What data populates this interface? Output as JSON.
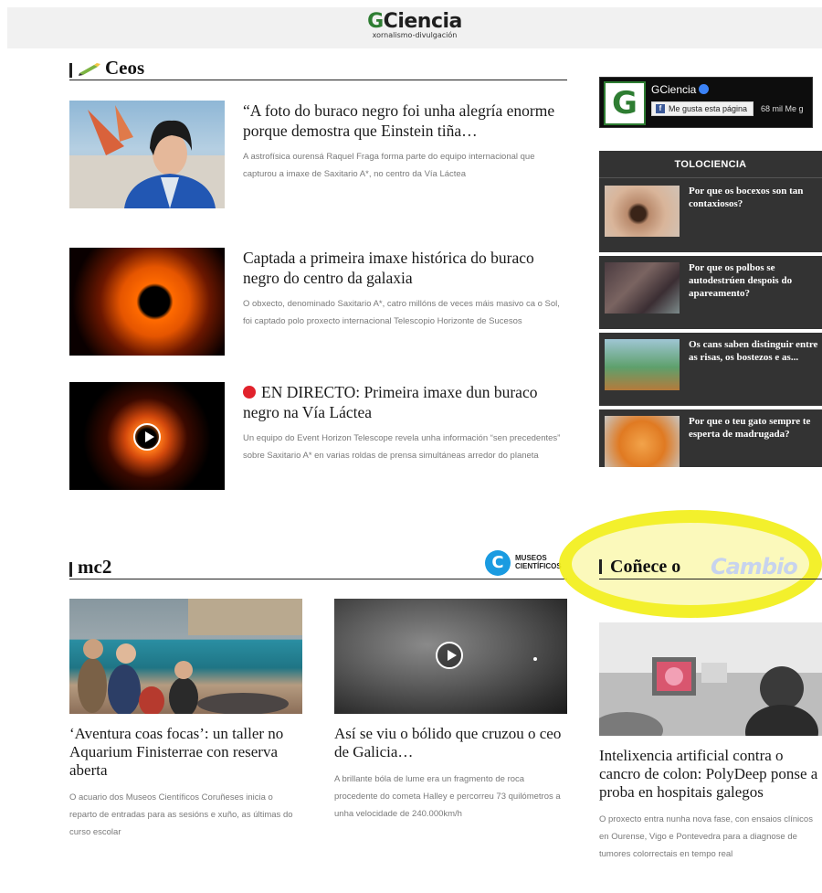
{
  "brand": {
    "logo_primary": "G",
    "logo_rest": "Ciencia",
    "tagline": "xornalismo-divulgación",
    "accent_color": "#2e7d32"
  },
  "ceos": {
    "section_title": "Ceos",
    "articles": [
      {
        "title": "“A foto do buraco negro foi unha alegría enorme porque demostra que Einstein tiña…",
        "excerpt": "A astrofísica ourensá Raquel Fraga forma parte do equipo internacional que capturou a imaxe de Saxitario A*, no centro da Vía Láctea",
        "live": ""
      },
      {
        "title": "Captada a primeira imaxe histórica do buraco negro do centro da galaxia",
        "excerpt": "O obxecto, denominado Saxitario A*, catro millóns de veces máis masivo ca o Sol, foi captado polo proxecto internacional Telescopio Horizonte de Sucesos",
        "live": ""
      },
      {
        "title": "EN DIRECTO: Primeira imaxe dun buraco negro na Vía Láctea",
        "excerpt": "Un equipo do Event Horizon Telescope revela unha información “sen precedentes” sobre Saxitario A* en varias roldas de prensa simultáneas arredor do planeta",
        "live": "true"
      }
    ]
  },
  "facebook": {
    "page_name": "GCiencia",
    "like_label": "Me gusta esta página",
    "likes": "68 mil Me g",
    "logo_letter": "G"
  },
  "toloscience": {
    "title": "TOLOCIENCIA",
    "items": [
      {
        "title": "Por que os bocexos son tan contaxiosos?"
      },
      {
        "title": "Por que os polbos se autodestrúen despois do apareamento?"
      },
      {
        "title": "Os cans saben distinguir entre as risas, os bostezos e as..."
      },
      {
        "title": "Por que o teu gato sempre te esperta de madrugada?"
      }
    ]
  },
  "mc2": {
    "section_title": "mc2",
    "logo_letter": "C",
    "logo_line1": "MUSEOS",
    "logo_line2": "CIENTÍFICOS",
    "articles": [
      {
        "title": "‘Aventura coas focas’: un taller no Aquarium Finisterrae con reserva aberta",
        "excerpt": "O acuario dos Museos Científicos Coruñeses inicia o reparto de entradas para as sesións e xuño, as últimas do curso escolar"
      },
      {
        "title": "Así se viu o bólido que cruzou o ceo de Galicia…",
        "excerpt": "A brillante bóla de lume era un fragmento de roca procedente do cometa Halley e percorreu 73 quilómetros a unha velocidade de 240.000km/h"
      }
    ]
  },
  "conece": {
    "title": "Coñece o",
    "brand_word": "Cambio",
    "highlight_color": "#f2ef1b",
    "article": {
      "title": "Intelixencia artificial contra o cancro de colon: PolyDeep ponse a proba en hospitais galegos",
      "excerpt": "O proxecto entra nunha nova fase, con ensaios clínicos en Ourense, Vigo e Pontevedra para a diagnose de tumores colorrectais en tempo real"
    }
  }
}
